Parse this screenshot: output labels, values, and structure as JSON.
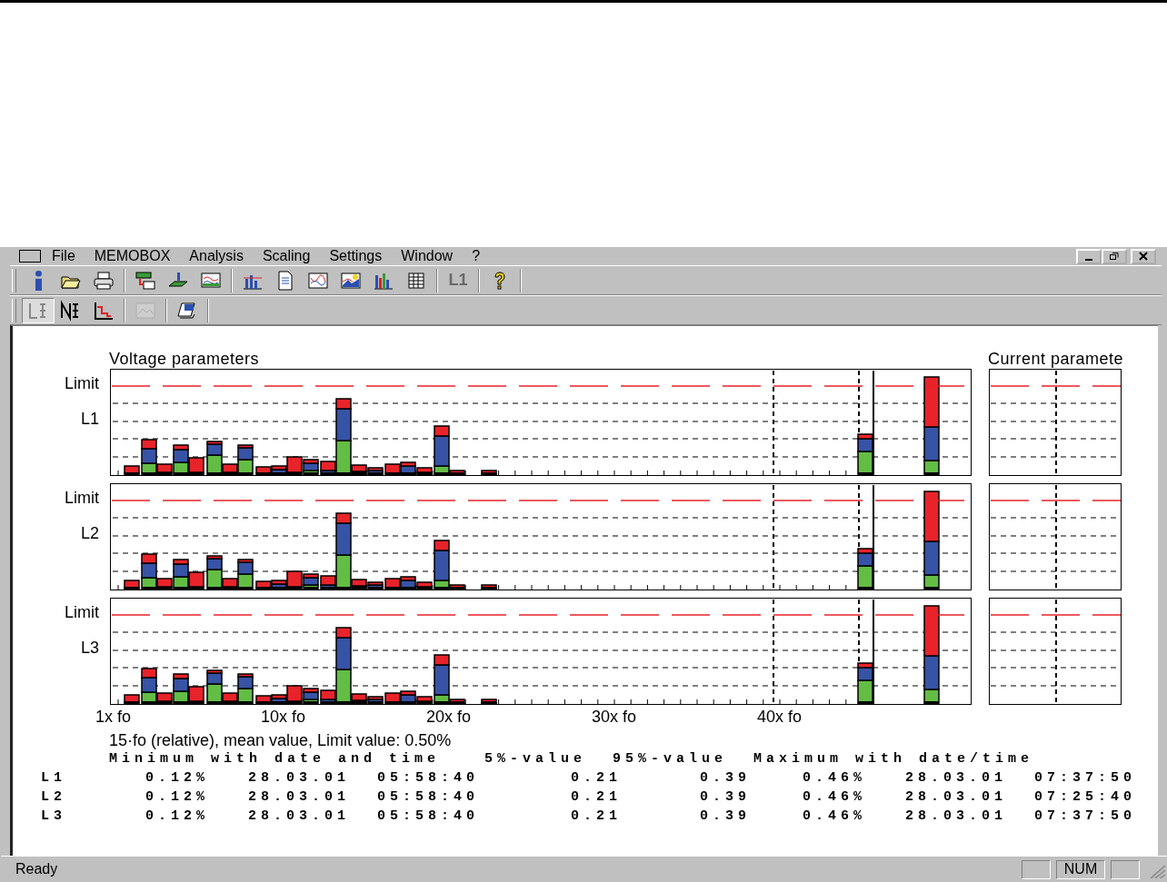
{
  "menu": [
    {
      "label": "File"
    },
    {
      "label": "MEMOBOX"
    },
    {
      "label": "Analysis"
    },
    {
      "label": "Scaling"
    },
    {
      "label": "Settings"
    },
    {
      "label": "Window"
    },
    {
      "label": "?"
    }
  ],
  "toolbars": [
    [
      {
        "kind": "button",
        "disabled": false
      },
      {
        "kind": "button",
        "disabled": false
      },
      {
        "kind": "button",
        "disabled": false
      },
      {
        "kind": "separator"
      },
      {
        "kind": "button",
        "disabled": false
      },
      {
        "kind": "button",
        "disabled": false
      },
      {
        "kind": "button",
        "disabled": false
      },
      {
        "kind": "separator"
      },
      {
        "kind": "button",
        "disabled": false
      },
      {
        "kind": "button",
        "disabled": false
      },
      {
        "kind": "button",
        "disabled": false
      },
      {
        "kind": "button",
        "disabled": false
      },
      {
        "kind": "button",
        "disabled": false
      },
      {
        "kind": "button",
        "disabled": false
      },
      {
        "kind": "separator"
      },
      {
        "kind": "text",
        "label": "L1",
        "disabled": true
      },
      {
        "kind": "separator"
      },
      {
        "kind": "button",
        "disabled": false
      }
    ],
    [
      {
        "kind": "button",
        "disabled": false,
        "selected": true
      },
      {
        "kind": "button",
        "disabled": false,
        "selected": false
      },
      {
        "kind": "button",
        "disabled": false,
        "selected": false
      },
      {
        "kind": "separator"
      },
      {
        "kind": "button",
        "disabled": true,
        "selected": false
      },
      {
        "kind": "separator"
      },
      {
        "kind": "button",
        "disabled": false,
        "selected": false
      }
    ]
  ],
  "voltage": {
    "title": "Voltage parameters",
    "rows": [
      {
        "limit_label": "Limit",
        "phase": "L1"
      },
      {
        "limit_label": "Limit",
        "phase": "L2"
      },
      {
        "limit_label": "Limit",
        "phase": "L3"
      }
    ]
  },
  "current": {
    "title": "Current paramete"
  },
  "x_labels": [
    "1x fo",
    "10x fo",
    "20x fo",
    "30x fo",
    "40x fo"
  ],
  "caption": "15·fo (relative), mean value, Limit value: 0.50%",
  "statistics": {
    "heading": [
      "Minimum with date and time",
      "5%-value",
      "95%-value",
      "Maximum with date/time"
    ],
    "rows": [
      {
        "phase": "L1",
        "cells": [
          "0.12%",
          "28.03.01",
          "05:58:40",
          "0.21",
          "0.39",
          "0.46%",
          "28.03.01",
          "07:37:50"
        ]
      },
      {
        "phase": "L2",
        "cells": [
          "0.12%",
          "28.03.01",
          "05:58:40",
          "0.21",
          "0.39",
          "0.46%",
          "28.03.01",
          "07:25:40"
        ]
      },
      {
        "phase": "L3",
        "cells": [
          "0.12%",
          "28.03.01",
          "05:58:40",
          "0.21",
          "0.39",
          "0.46%",
          "28.03.01",
          "07:37:50"
        ]
      }
    ]
  },
  "status_bar": {
    "text": "Ready",
    "indicator": "NUM"
  }
}
